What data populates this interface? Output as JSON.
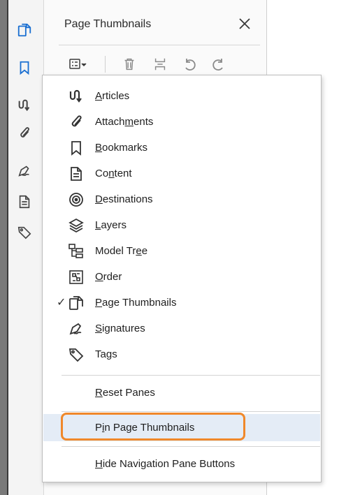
{
  "pane": {
    "title": "Page Thumbnails",
    "close_icon": "close-icon"
  },
  "toolbar": {
    "options_icon": "options-menu-icon",
    "delete_icon": "trash-icon",
    "insert_icon": "insert-pages-icon",
    "undo_icon": "rotate-left-icon",
    "redo_icon": "rotate-right-icon"
  },
  "nav_buttons": [
    {
      "name": "page-thumbnails",
      "icon": "page-thumbnails-icon"
    },
    {
      "name": "bookmarks",
      "icon": "bookmark-icon"
    },
    {
      "name": "articles",
      "icon": "articles-icon"
    },
    {
      "name": "attachments",
      "icon": "paperclip-icon"
    },
    {
      "name": "signatures",
      "icon": "signature-icon"
    },
    {
      "name": "content",
      "icon": "content-icon"
    },
    {
      "name": "tags",
      "icon": "tag-icon"
    }
  ],
  "menu": {
    "items": [
      {
        "label_pre": "",
        "label_u": "A",
        "label_post": "rticles",
        "checked": false,
        "icon": "articles-icon"
      },
      {
        "label_pre": "Attach",
        "label_u": "m",
        "label_post": "ents",
        "checked": false,
        "icon": "paperclip-icon"
      },
      {
        "label_pre": "",
        "label_u": "B",
        "label_post": "ookmarks",
        "checked": false,
        "icon": "bookmark-icon"
      },
      {
        "label_pre": "Co",
        "label_u": "n",
        "label_post": "tent",
        "checked": false,
        "icon": "content-icon"
      },
      {
        "label_pre": "",
        "label_u": "D",
        "label_post": "estinations",
        "checked": false,
        "icon": "destinations-icon"
      },
      {
        "label_pre": "",
        "label_u": "L",
        "label_post": "ayers",
        "checked": false,
        "icon": "layers-icon"
      },
      {
        "label_pre": "Model Tr",
        "label_u": "e",
        "label_post": "e",
        "checked": false,
        "icon": "model-tree-icon"
      },
      {
        "label_pre": "",
        "label_u": "O",
        "label_post": "rder",
        "checked": false,
        "icon": "order-icon"
      },
      {
        "label_pre": "",
        "label_u": "P",
        "label_post": "age Thumbnails",
        "checked": true,
        "icon": "page-thumbnails-icon"
      },
      {
        "label_pre": "",
        "label_u": "S",
        "label_post": "ignatures",
        "checked": false,
        "icon": "signature-icon"
      },
      {
        "label_pre": "Ta",
        "label_u": "g",
        "label_post": "s",
        "checked": false,
        "icon": "tag-icon"
      }
    ],
    "reset": {
      "label_pre": "",
      "label_u": "R",
      "label_post": "eset Panes"
    },
    "pin": {
      "label_pre": "P",
      "label_u": "i",
      "label_post": "n Page Thumbnails"
    },
    "hide": {
      "label_pre": "",
      "label_u": "H",
      "label_post": "ide Navigation Pane Buttons"
    },
    "check_mark": "✓"
  },
  "colors": {
    "accent_blue": "#1a6fd1",
    "highlight": "#e4ecf6",
    "ring": "#f0882a"
  }
}
